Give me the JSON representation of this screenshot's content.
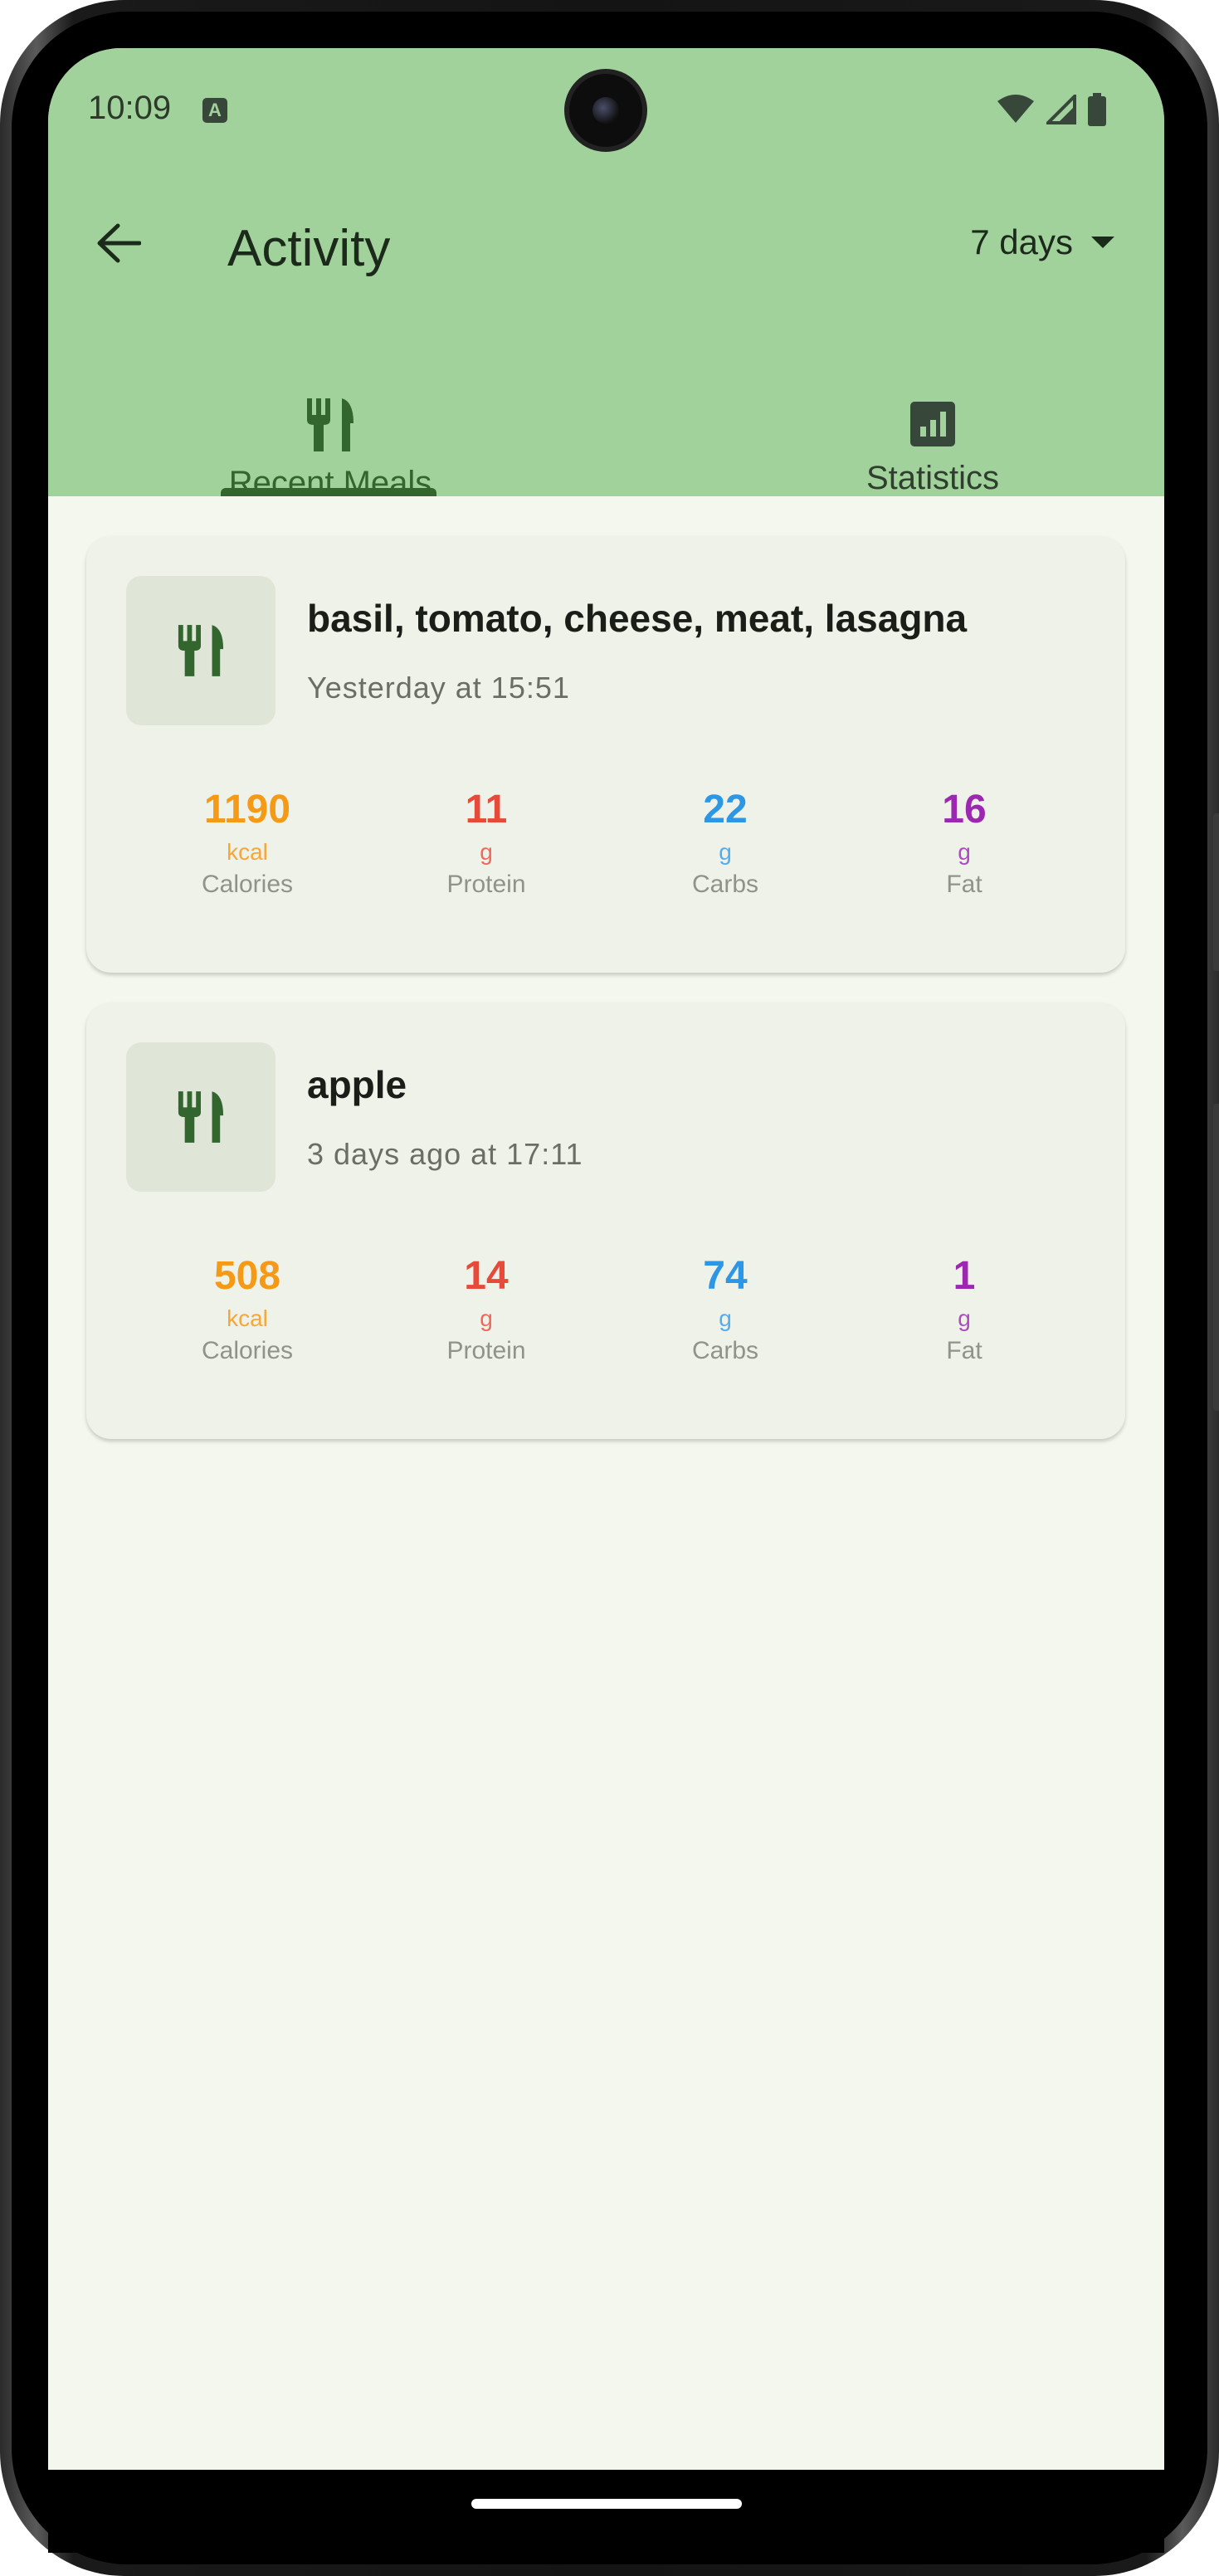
{
  "status_bar": {
    "time": "10:09",
    "notification_icon": "text-a-icon",
    "icons": [
      "wifi-icon",
      "cellular-icon",
      "battery-icon"
    ]
  },
  "toolbar": {
    "back_icon": "arrow-left-icon",
    "title": "Activity",
    "period_label": "7 days",
    "period_icon": "dropdown-caret-icon"
  },
  "tabs": [
    {
      "label": "Recent Meals",
      "icon": "fork-knife-icon",
      "active": true
    },
    {
      "label": "Statistics",
      "icon": "bar-chart-icon",
      "active": false
    }
  ],
  "colors": {
    "app_bar": "#a2d29b",
    "accent": "#33652e",
    "calories": "#f59a16",
    "protein": "#e84a3a",
    "carbs": "#2d97e6",
    "fat": "#9c27b0"
  },
  "meals": [
    {
      "name": "basil, tomato, cheese, meat, lasagna",
      "time": "Yesterday at 15:51",
      "icon": "fork-knife-icon",
      "nutrients": [
        {
          "value": "1190",
          "unit": "kcal",
          "label": "Calories"
        },
        {
          "value": "11",
          "unit": "g",
          "label": "Protein"
        },
        {
          "value": "22",
          "unit": "g",
          "label": "Carbs"
        },
        {
          "value": "16",
          "unit": "g",
          "label": "Fat"
        }
      ]
    },
    {
      "name": "apple",
      "time": "3 days ago at 17:11",
      "icon": "fork-knife-icon",
      "nutrients": [
        {
          "value": "508",
          "unit": "kcal",
          "label": "Calories"
        },
        {
          "value": "14",
          "unit": "g",
          "label": "Protein"
        },
        {
          "value": "74",
          "unit": "g",
          "label": "Carbs"
        },
        {
          "value": "1",
          "unit": "g",
          "label": "Fat"
        }
      ]
    }
  ]
}
